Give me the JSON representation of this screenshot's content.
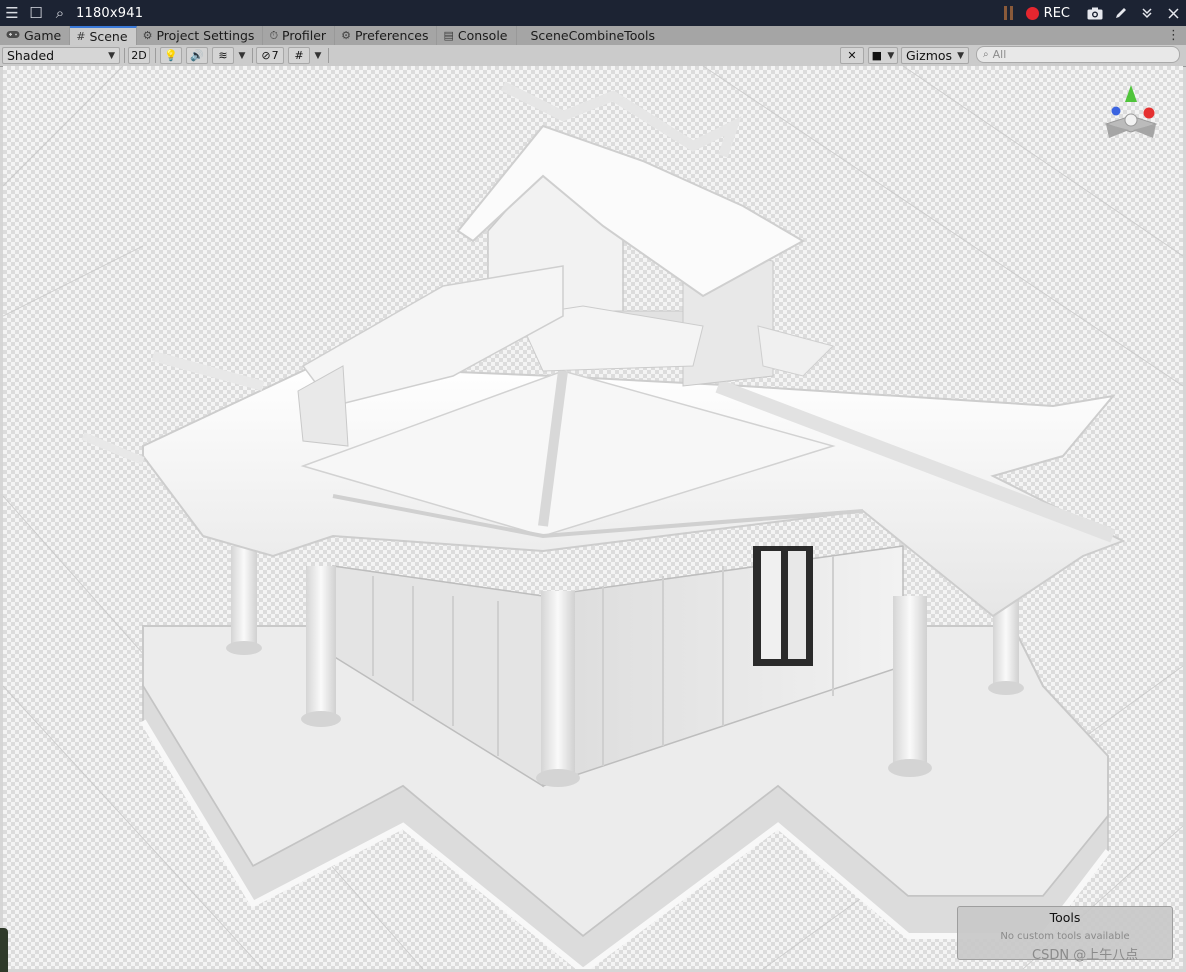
{
  "capture_bar": {
    "resolution": "1180x941",
    "rec_label": "REC",
    "icons": [
      "hamburger-icon",
      "square-icon",
      "screen-zoom-icon",
      "pause-indicator",
      "record-dot-icon",
      "camera-icon",
      "pen-icon",
      "chevron-double-down-icon",
      "close-icon"
    ],
    "rec_color": "#e5262f",
    "bar_color": "#1c2333"
  },
  "tabs": [
    {
      "label": "Game",
      "icon": "gamepad-icon"
    },
    {
      "label": "Scene",
      "icon": "hash-icon",
      "active": true
    },
    {
      "label": "Project Settings",
      "icon": "gear-icon"
    },
    {
      "label": "Profiler",
      "icon": "profiler-icon"
    },
    {
      "label": "Preferences",
      "icon": "gear-icon"
    },
    {
      "label": "Console",
      "icon": "console-icon"
    },
    {
      "label": "SceneCombineTools",
      "icon": ""
    }
  ],
  "toolbar": {
    "draw_mode": "Shaded",
    "mode_2d": "2D",
    "hidden_count": "7",
    "gizmos_label": "Gizmos",
    "search_placeholder": "All",
    "accent": "#3a79d8"
  },
  "orientation_gizmo": {
    "axes": [
      "y-axis-green",
      "x-axis-red",
      "z-axis-blue"
    ]
  },
  "tools_overlay": {
    "title": "Tools",
    "subtitle": "No custom tools available"
  },
  "watermark": "CSDN @上午八点"
}
